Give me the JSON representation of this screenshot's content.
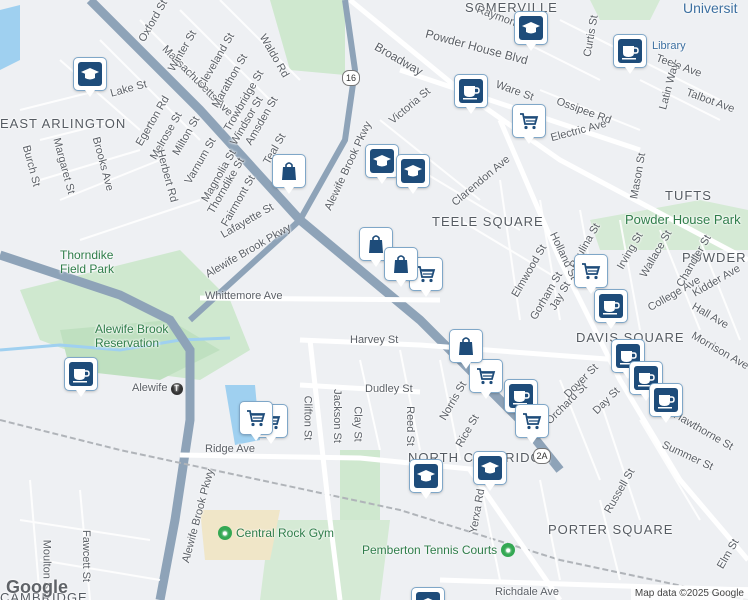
{
  "map": {
    "areas": [
      "SOMERVILLE",
      "EAST ARLINGTON",
      "TUFTS",
      "TEELE SQUARE",
      "NORTH CAMBRIDGE",
      "PORTER SQUARE",
      "DAVIS SQUARE",
      "POWDER HOUSE"
    ],
    "parks": [
      "Thorndike Field Park",
      "Alewife Brook Reservation",
      "Powder House Park",
      "Central Rock Gym",
      "Pemberton Tennis Courts"
    ],
    "streets": [
      "Massachusetts Ave",
      "Alewife Brook Pkwy",
      "Broadway",
      "Powder House Blvd",
      "Holland St",
      "College Ave",
      "Elm St",
      "Harvey St",
      "Dudley St",
      "Whittemore Ave",
      "Ridge Ave",
      "Summer St",
      "Teele Ave",
      "Clarendon Ave",
      "Victoria St",
      "Oxford St",
      "Winter St",
      "Lake St",
      "Cleveland St",
      "Marathon St",
      "Waldo Rd",
      "Trowbridge St",
      "Windsor St",
      "Amsden St",
      "Milton St",
      "Varnum St",
      "Magnolia St",
      "Thorndike St",
      "Fairmont St",
      "Lafayette St",
      "Egerton Rd",
      "Melrose St",
      "Herbert Rd",
      "Brooks Ave",
      "Margaret St",
      "Burch St",
      "Clifton St",
      "Jackson St",
      "Clay St",
      "Reed St",
      "Norris St",
      "Rice St",
      "Orchard St",
      "Day St",
      "Dover St",
      "Russell St",
      "Hawthorne St",
      "Elmwood St",
      "Gorham St",
      "Jay St",
      "Paulina St",
      "Irving St",
      "Wallace St",
      "Chandler St",
      "Kidder Ave",
      "Hall Ave",
      "Morrison Ave",
      "Mason St",
      "Curtis St",
      "Talbot Ave",
      "Latin Way",
      "Ware St",
      "Ossipee Rd",
      "Electric Ave",
      "Raymond Ave",
      "Richdale Ave",
      "Moulton St",
      "Fawcett St",
      "Yerxa Rd",
      "Teal St"
    ],
    "station": "Alewife",
    "library": "Library",
    "university": "Universit",
    "route_shield": "16",
    "route_shield_2": "2A",
    "brand": "Google",
    "attribution": "Map data ©2025 Google",
    "partial_labels": {
      "cambridge": "CAMBRIDGE",
      "porter": "PORTER SQUARE"
    }
  },
  "markers": [
    {
      "type": "school-icon"
    },
    {
      "type": "school-icon"
    },
    {
      "type": "school-icon"
    },
    {
      "type": "school-icon"
    },
    {
      "type": "school-icon"
    },
    {
      "type": "school-icon"
    },
    {
      "type": "school-icon"
    },
    {
      "type": "cafe-icon"
    },
    {
      "type": "cafe-icon"
    },
    {
      "type": "cafe-icon"
    },
    {
      "type": "cafe-icon"
    },
    {
      "type": "cafe-icon"
    },
    {
      "type": "cafe-icon"
    },
    {
      "type": "cafe-icon"
    },
    {
      "type": "cafe-icon"
    },
    {
      "type": "grocery-icon"
    },
    {
      "type": "grocery-icon"
    },
    {
      "type": "grocery-icon"
    },
    {
      "type": "grocery-icon"
    },
    {
      "type": "grocery-icon"
    },
    {
      "type": "grocery-icon"
    },
    {
      "type": "grocery-icon"
    },
    {
      "type": "shopping-icon"
    },
    {
      "type": "shopping-icon"
    },
    {
      "type": "shopping-icon"
    },
    {
      "type": "shopping-icon"
    }
  ],
  "colors": {
    "land": "#eef0f3",
    "park": "#c8e6c9",
    "water": "#9fd0f0",
    "highway": "#8ea3b8",
    "road": "#ffffff",
    "marker": "#1e4c7a"
  }
}
